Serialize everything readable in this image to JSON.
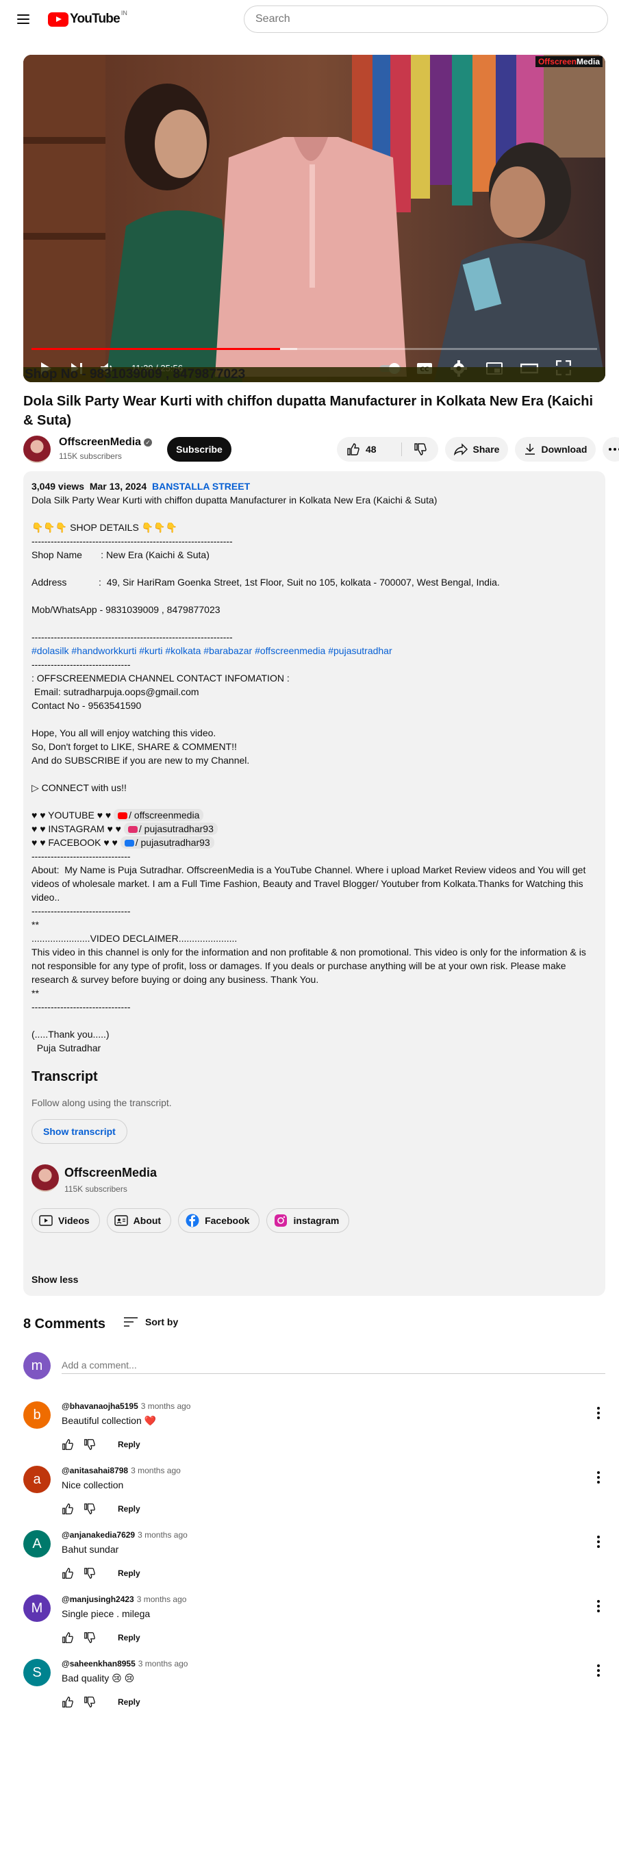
{
  "header": {
    "logo_text": "YouTube",
    "logo_country": "IN",
    "search_placeholder": "Search"
  },
  "player": {
    "channel_bug_a": "Offscreen",
    "channel_bug_b": "Media",
    "overlay_text": "Shop No - 9831039009 , 8479877023",
    "time": "11:29 / 25:56",
    "progress_fraction": 0.44,
    "buffer_fraction": 0.47
  },
  "video": {
    "title": "Dola Silk Party Wear Kurti with chiffon dupatta Manufacturer in Kolkata New Era (Kaichi & Suta)",
    "channel_name": "OffscreenMedia",
    "subscribers": "115K subscribers",
    "subscribe_label": "Subscribe",
    "likes": "48",
    "share_label": "Share",
    "download_label": "Download"
  },
  "description": {
    "views": "3,049 views",
    "date": "Mar 13, 2024",
    "location_tag": "BANSTALLA STREET",
    "lines": [
      "Dola Silk Party Wear Kurti with chiffon dupatta Manufacturer in Kolkata New Era (Kaichi & Suta)",
      "",
      "👇👇👇 SHOP DETAILS 👇👇👇",
      "---------------------------------------------------------------",
      "Shop Name       : New Era (Kaichi & Suta)",
      "",
      "Address            :  49, Sir HariRam Goenka Street, 1st Floor, Suit no 105, kolkata - 700007, West Bengal, India.",
      "",
      "Mob/WhatsApp - 9831039009 , 8479877023",
      "",
      "---------------------------------------------------------------"
    ],
    "hashtags": [
      "#dolasilk",
      "#handworkkurti",
      "#kurti",
      "#kolkata",
      "#barabazar",
      "#offscreenmedia",
      "#pujasutradhar"
    ],
    "lines2": [
      "-------------------------------",
      ": OFFSCREENMEDIA CHANNEL CONTACT INFOMATION :",
      " Email: sutradharpuja.oops@gmail.com",
      "Contact No - 9563541590",
      "",
      "Hope, You all will enjoy watching this video.",
      "So, Don't forget to LIKE, SHARE & COMMENT!!",
      "And do SUBSCRIBE if you are new to my Channel.",
      "",
      "▷ CONNECT with us!!",
      ""
    ],
    "social": [
      {
        "prefix": "♥ ♥ YOUTUBE ♥ ♥ ",
        "chip": "/ offscreenmedia",
        "color": "#ff0000"
      },
      {
        "prefix": "♥ ♥ INSTAGRAM ♥ ♥ ",
        "chip": "/ pujasutradhar93",
        "color": "#e1306c"
      },
      {
        "prefix": "♥ ♥ FACEBOOK ♥ ♥ ",
        "chip": "/ pujasutradhar93",
        "color": "#1877f2"
      }
    ],
    "lines3": [
      "-------------------------------",
      "About:  My Name is Puja Sutradhar. OffscreenMedia is a YouTube Channel. Where i upload Market Review videos and You will get videos of wholesale market. I am a Full Time Fashion, Beauty and Travel Blogger/ Youtuber from Kolkata.Thanks for Watching this video..",
      "-------------------------------",
      "**",
      "......................VIDEO DECLAIMER......................",
      "This video in this channel is only for the information and non profitable & non promotional. This video is only for the information & is not responsible for any type of profit, loss or damages. If you deals or purchase anything will be at your own risk. Please make research & survey before buying or doing any business. Thank You.",
      "**",
      "-------------------------------",
      "",
      "(.....Thank you.....)",
      "  Puja Sutradhar"
    ],
    "transcript_heading": "Transcript",
    "transcript_sub": "Follow along using the transcript.",
    "show_transcript": "Show transcript",
    "channel_name": "OffscreenMedia",
    "channel_subs": "115K subscribers",
    "links": [
      "Videos",
      "About",
      "Facebook",
      "instagram"
    ],
    "show_less": "Show less"
  },
  "comments": {
    "count_label": "8 Comments",
    "sort_label": "Sort by",
    "add_placeholder": "Add a comment...",
    "my_avatar_letter": "m",
    "reply_label": "Reply",
    "items": [
      {
        "author": "@bhavanaojha5195",
        "time": "3 months ago",
        "text": "Beautiful  collection ",
        "heart": "❤️",
        "letter": "b",
        "color": "#ef6c00"
      },
      {
        "author": "@anitasahai8798",
        "time": "3 months ago",
        "text": "Nice collection",
        "heart": "",
        "letter": "a",
        "color": "#bf360c"
      },
      {
        "author": "@anjanakedia7629",
        "time": "3 months ago",
        "text": "Bahut sundar",
        "heart": "",
        "letter": "A",
        "color": "#00796b"
      },
      {
        "author": "@manjusingh2423",
        "time": "3 months ago",
        "text": "Single piece . milega",
        "heart": "",
        "letter": "M",
        "color": "#5e35b1"
      },
      {
        "author": "@saheenkhan8955",
        "time": "3 months ago",
        "text": "Bad quality 😢 😢",
        "heart": "",
        "letter": "S",
        "color": "#00838f"
      }
    ]
  }
}
